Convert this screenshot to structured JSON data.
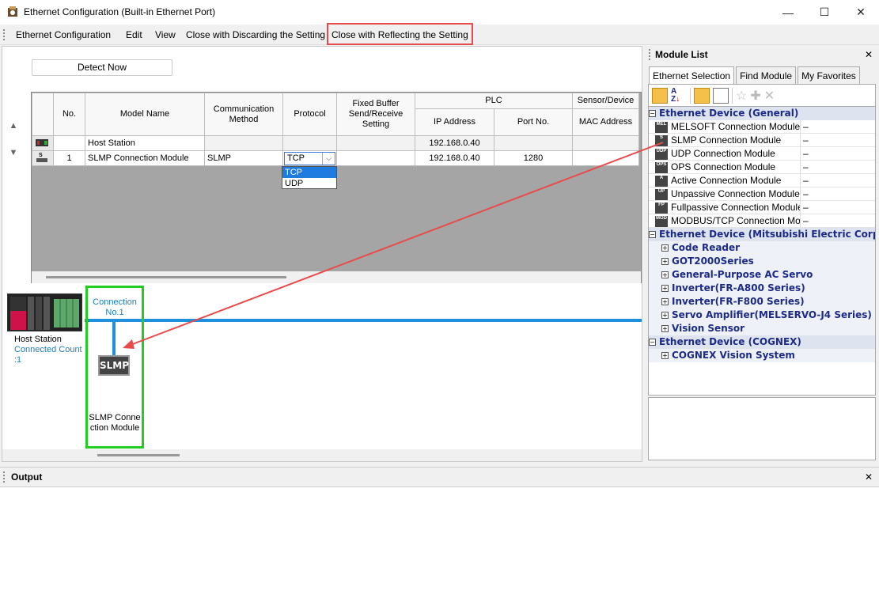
{
  "window": {
    "title": "Ethernet Configuration (Built-in Ethernet Port)",
    "minimize": "—",
    "maximize": "☐",
    "close": "✕"
  },
  "menu": {
    "items": [
      "Ethernet Configuration",
      "Edit",
      "View",
      "Close with Discarding the Setting",
      "Close with Reflecting the Setting"
    ]
  },
  "toolbar": {
    "detect_now": "Detect Now"
  },
  "grid": {
    "headers": {
      "no": "No.",
      "model": "Model Name",
      "comm": "Communication Method",
      "protocol": "Protocol",
      "fixed": "Fixed Buffer Send/Receive Setting",
      "plc": "PLC",
      "ip": "IP Address",
      "port": "Port No.",
      "sensor": "Sensor/Device",
      "mac": "MAC Address"
    },
    "rows": [
      {
        "no": "",
        "model": "Host Station",
        "comm": "",
        "protocol": "",
        "fixed": "",
        "ip": "192.168.0.40",
        "port": "",
        "mac": ""
      },
      {
        "no": "1",
        "model": "SLMP Connection Module",
        "comm": "SLMP",
        "protocol": "TCP",
        "fixed": "",
        "ip": "192.168.0.40",
        "port": "1280",
        "mac": ""
      }
    ],
    "protocol_options": [
      "TCP",
      "UDP"
    ],
    "selected_protocol": "TCP"
  },
  "diagram": {
    "host_label": "Host Station",
    "connected_count": "Connected Count",
    "count_value": ":1",
    "connection_label": "Connection",
    "connection_no": "No.1",
    "slmp_badge": "SLMP",
    "module_label_1": "SLMP Conne",
    "module_label_2": "ction Module"
  },
  "module_list": {
    "title": "Module List",
    "tabs": [
      "Ethernet Selection",
      "Find Module",
      "My Favorites"
    ],
    "categories": [
      {
        "label": "Ethernet Device (General)",
        "items": [
          {
            "icon": "MEL",
            "label": "MELSOFT Connection Module",
            "val": "–"
          },
          {
            "icon": "S",
            "label": "SLMP Connection Module",
            "val": "–"
          },
          {
            "icon": "UDP",
            "label": "UDP Connection Module",
            "val": "–"
          },
          {
            "icon": "OPS",
            "label": "OPS Connection Module",
            "val": "–"
          },
          {
            "icon": "A",
            "label": "Active Connection Module",
            "val": "–"
          },
          {
            "icon": "UP",
            "label": "Unpassive Connection Module",
            "val": "–"
          },
          {
            "icon": "FP",
            "label": "Fullpassive Connection Module",
            "val": "–"
          },
          {
            "icon": "MOD",
            "label": "MODBUS/TCP Connection Module",
            "val": "–"
          }
        ]
      },
      {
        "label": "Ethernet Device (Mitsubishi Electric Corporation)",
        "subs": [
          "Code Reader",
          "GOT2000Series",
          "General-Purpose AC Servo",
          "Inverter(FR-A800 Series)",
          "Inverter(FR-F800 Series)",
          "Servo Amplifier(MELSERVO-J4 Series)",
          "Vision Sensor"
        ]
      },
      {
        "label": "Ethernet Device (COGNEX)",
        "subs": [
          "COGNEX Vision System"
        ]
      }
    ]
  },
  "output": {
    "title": "Output"
  },
  "colors": {
    "highlight_red": "#e84b4b",
    "diagram_green": "#22cc22",
    "line_blue": "#1e90e0"
  }
}
